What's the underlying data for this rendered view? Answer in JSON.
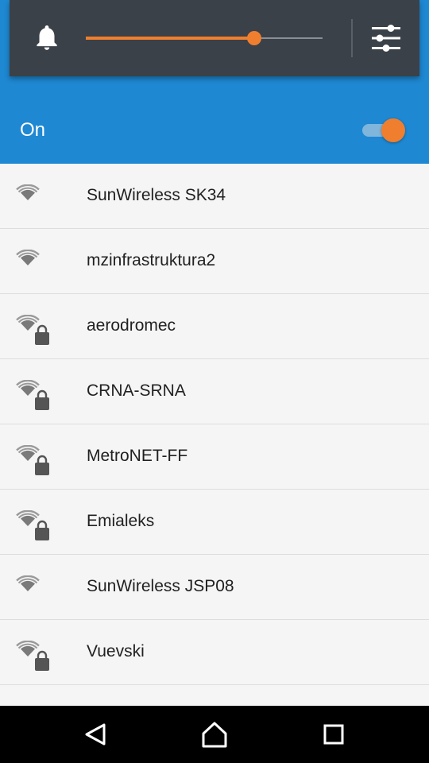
{
  "volume": {
    "level": 0.71,
    "accent_color": "#ef7f2f",
    "icon": "bell-icon",
    "settings_icon": "sliders-icon"
  },
  "wifi": {
    "status_label": "On",
    "enabled": true,
    "bar_color": "#1e88d2"
  },
  "networks": [
    {
      "name": "SunWireless SK34",
      "secured": false
    },
    {
      "name": "mzinfrastruktura2",
      "secured": false
    },
    {
      "name": "aerodromec",
      "secured": true
    },
    {
      "name": "CRNA-SRNA",
      "secured": true
    },
    {
      "name": "MetroNET-FF",
      "secured": true
    },
    {
      "name": "Emialeks",
      "secured": true
    },
    {
      "name": "SunWireless JSP08",
      "secured": false
    },
    {
      "name": "Vuevski",
      "secured": true
    },
    {
      "name": "",
      "secured": false
    }
  ],
  "navigation": {
    "icons": [
      "back-icon",
      "home-icon",
      "recents-icon"
    ]
  }
}
